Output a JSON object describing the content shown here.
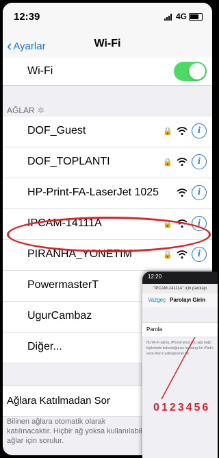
{
  "status": {
    "time": "12:39",
    "network": "4G"
  },
  "nav": {
    "back_label": "Ayarlar",
    "title": "Wi-Fi"
  },
  "wifi_toggle": {
    "label": "Wi-Fi",
    "on": true
  },
  "section": {
    "header": "AĞLAR"
  },
  "networks": [
    {
      "name": "DOF_Guest",
      "locked": true
    },
    {
      "name": "DOF_TOPLANTI",
      "locked": true
    },
    {
      "name": "HP-Print-FA-LaserJet 1025",
      "locked": false
    },
    {
      "name": "IPCAM-14111A",
      "locked": true
    },
    {
      "name": "PIRANHA_YONETIM",
      "locked": true
    },
    {
      "name": "PowermasterT",
      "locked": false
    },
    {
      "name": "UgurCambaz",
      "locked": false
    },
    {
      "name": "Diğer...",
      "locked": false
    }
  ],
  "ask": {
    "label": "Ağlara Katılmadan Sor"
  },
  "footer": {
    "text": "Bilinen ağlara otomatik olarak katılınacaktır. Hiçbir ağ yoksa kullanılabilir ağlar için sorulur."
  },
  "inset": {
    "time": "12:20",
    "prompt": "\"IPCAM-14111A\" için parolayı",
    "cancel": "Vazgeç",
    "title": "Parolayı Girin",
    "password_label": "Parola",
    "description": "Bu Wi-Fi ağına, iPhone'unuzu bu ağa bağlı kişilerinde bulunduğunuz herhangi bir iPad'e veya Mac'e yaklaştırarak da"
  },
  "annotation": {
    "password": "0123456"
  },
  "colors": {
    "accent": "#1a73e8",
    "toggle_on": "#4cd964",
    "annotation": "#d8232a"
  }
}
